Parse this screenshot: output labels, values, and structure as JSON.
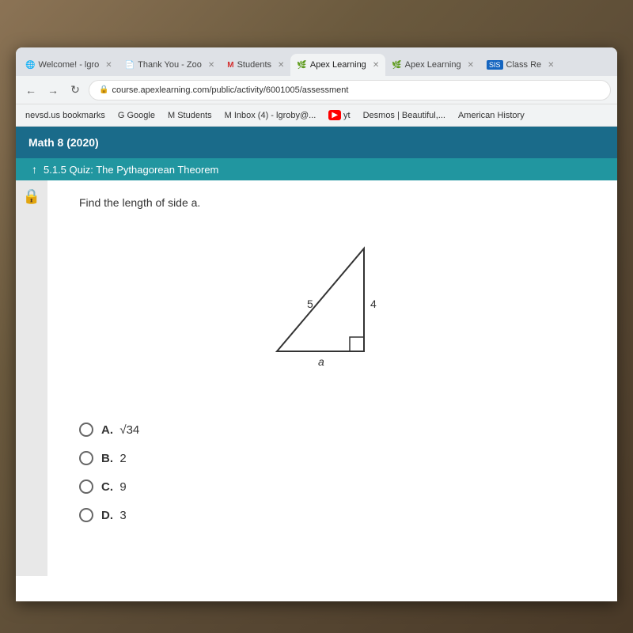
{
  "background": {
    "color": "#6B5A3E"
  },
  "browser": {
    "tabs": [
      {
        "id": "tab-welcome",
        "label": "Welcome! - lgro",
        "active": false,
        "icon": "🌐"
      },
      {
        "id": "tab-thank-you",
        "label": "Thank You - Zoo",
        "active": false,
        "icon": "📄"
      },
      {
        "id": "tab-students",
        "label": "Students",
        "active": false,
        "icon": "M"
      },
      {
        "id": "tab-apex-1",
        "label": "Apex Learning",
        "active": true,
        "icon": "🌿"
      },
      {
        "id": "tab-apex-2",
        "label": "Apex Learning",
        "active": false,
        "icon": "🌿"
      },
      {
        "id": "tab-class",
        "label": "Class Re",
        "active": false,
        "icon": "SIS"
      }
    ],
    "address": {
      "url": "course.apexlearning.com/public/activity/6001005/assessment",
      "secure": true,
      "lock_icon": "🔒"
    },
    "bookmarks": [
      {
        "label": "nevsd.us bookmarks"
      },
      {
        "label": "G Google"
      },
      {
        "label": "M Students"
      },
      {
        "label": "M Inbox (4) - lgroby@..."
      },
      {
        "label": "yt"
      },
      {
        "label": "Desmos | Beautiful,..."
      },
      {
        "label": "American History"
      }
    ]
  },
  "apex": {
    "header_title": "Math 8 (2020)",
    "quiz_section": "5.1.5 Quiz:  The Pythagorean Theorem",
    "quiz_arrow": "↑",
    "question": "Find the length of side a.",
    "triangle": {
      "side_hypotenuse": "5",
      "side_vertical": "4",
      "side_bottom": "a"
    },
    "answers": [
      {
        "id": "A",
        "label": "A.",
        "math": "√34"
      },
      {
        "id": "B",
        "label": "B.",
        "math": "2"
      },
      {
        "id": "C",
        "label": "C.",
        "math": "9"
      },
      {
        "id": "D",
        "label": "D.",
        "math": "3"
      }
    ]
  },
  "labels": {
    "lock_icon": "🔒",
    "back": "←",
    "forward": "→",
    "refresh": "↻"
  }
}
